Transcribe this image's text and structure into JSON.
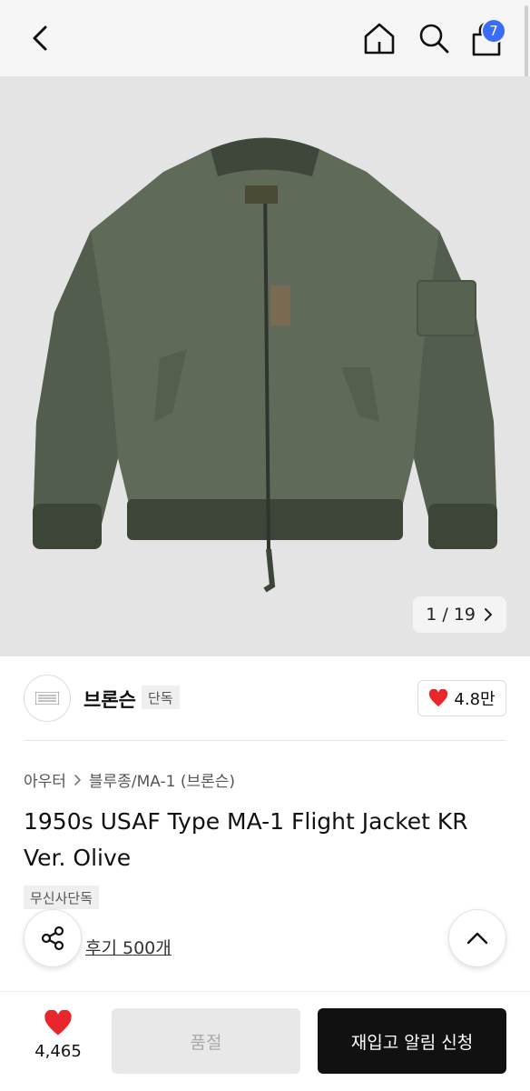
{
  "header": {
    "cart_count": "7",
    "icons": [
      "back-icon",
      "home-icon",
      "search-icon",
      "cart-icon"
    ]
  },
  "gallery": {
    "current": "1",
    "total": "19",
    "pager_text": "1 / 19"
  },
  "brand": {
    "name": "브론슨",
    "tag": "단독",
    "likes": "4.8만"
  },
  "product": {
    "breadcrumb": [
      "아우터",
      "블루종/MA-1 (브론슨)"
    ],
    "title": "1950s USAF Type MA-1 Flight Jacket KR Ver. Olive",
    "exclusive_tag": "무신사단독",
    "reviews": "후기 500개"
  },
  "bottom_bar": {
    "fav_count": "4,465",
    "soldout_label": "품절",
    "restock_label": "재입고 알림 신청"
  },
  "colors": {
    "accent_blue": "#3b6cf6",
    "heart_red": "#e8262b",
    "jacket_olive": "#5f6a58"
  }
}
